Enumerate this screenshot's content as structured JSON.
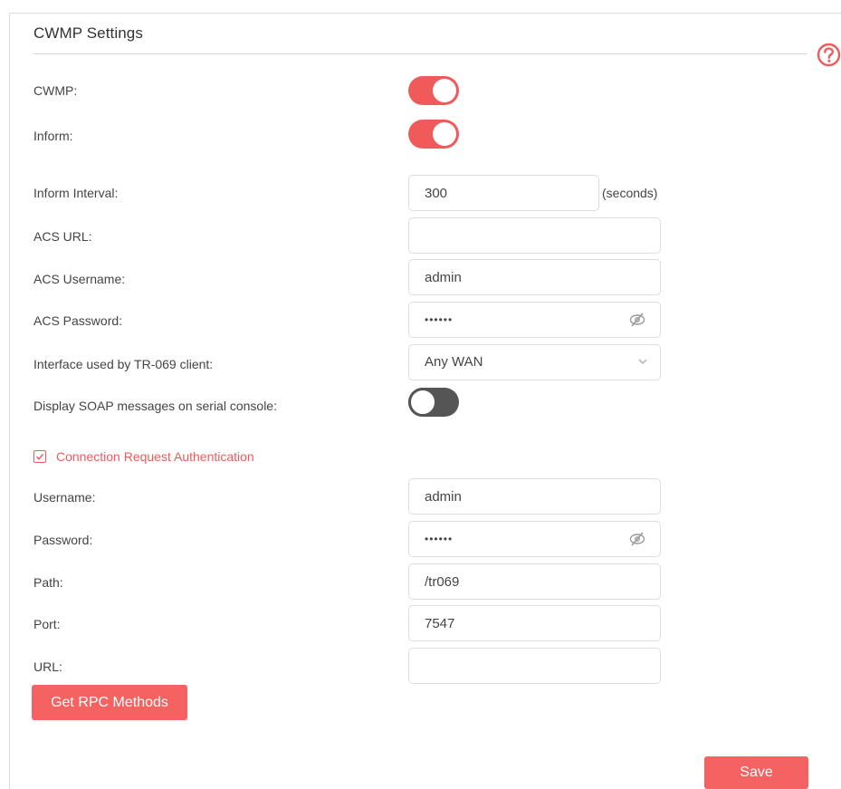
{
  "section": {
    "title": "CWMP Settings"
  },
  "help": {
    "icon": "help-circle-icon"
  },
  "cwmp": {
    "label": "CWMP:",
    "enabled": true
  },
  "inform": {
    "label": "Inform:",
    "enabled": true
  },
  "inform_interval": {
    "label": "Inform Interval:",
    "value": "300",
    "suffix": "(seconds)"
  },
  "acs_url": {
    "label": "ACS URL:",
    "value": ""
  },
  "acs_username": {
    "label": "ACS Username:",
    "value": "admin"
  },
  "acs_password": {
    "label": "ACS Password:",
    "value": "••••••",
    "icon": "eye-slash-icon"
  },
  "interface": {
    "label": "Interface used by TR-069 client:",
    "selected": "Any WAN",
    "icon": "chevron-down-icon"
  },
  "soap": {
    "label": "Display SOAP messages on serial console:",
    "enabled": false
  },
  "conn_auth": {
    "label": "Connection Request Authentication",
    "checked": true
  },
  "username": {
    "label": "Username:",
    "value": "admin"
  },
  "password": {
    "label": "Password:",
    "value": "••••••",
    "icon": "eye-slash-icon"
  },
  "path": {
    "label": "Path:",
    "value": "/tr069"
  },
  "port": {
    "label": "Port:",
    "value": "7547"
  },
  "url": {
    "label": "URL:",
    "value": ""
  },
  "buttons": {
    "rpc": "Get RPC Methods",
    "save": "Save"
  },
  "colors": {
    "accent": "#f05a5b",
    "button": "#f56262",
    "toggle_off": "#555555"
  }
}
